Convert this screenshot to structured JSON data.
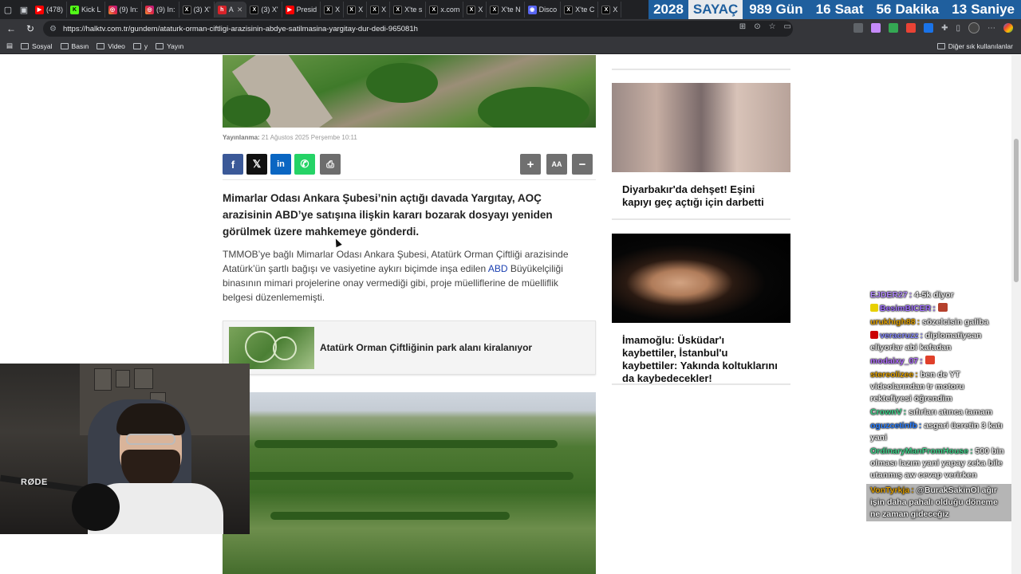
{
  "browser": {
    "tabs": [
      {
        "label": "(478)",
        "icon": "youtube"
      },
      {
        "label": "Kick L",
        "icon": "kick"
      },
      {
        "label": "(9) In:",
        "icon": "instagram"
      },
      {
        "label": "(9) In:",
        "icon": "instagram"
      },
      {
        "label": "(3) X'",
        "icon": "x"
      },
      {
        "label": "A",
        "icon": "halktv"
      },
      {
        "label": "(3) X'",
        "icon": "x"
      },
      {
        "label": "Presid",
        "icon": "youtube"
      },
      {
        "label": "X",
        "icon": "x"
      },
      {
        "label": "X",
        "icon": "x"
      },
      {
        "label": "X",
        "icon": "x"
      },
      {
        "label": "X'te s",
        "icon": "x"
      },
      {
        "label": "x.com",
        "icon": "x"
      },
      {
        "label": "X",
        "icon": "x"
      },
      {
        "label": "X'te N",
        "icon": "x"
      },
      {
        "label": "Disco",
        "icon": "discord"
      },
      {
        "label": "X'te C",
        "icon": "x"
      },
      {
        "label": "X",
        "icon": "x"
      }
    ],
    "url": "https://halktv.com.tr/gundem/ataturk-orman-ciftligi-arazisinin-abdye-satilmasina-yargitay-dur-dedi-965081h",
    "bookmarks": [
      {
        "label": "Sosyal"
      },
      {
        "label": "Basın"
      },
      {
        "label": "Video"
      },
      {
        "label": "y"
      },
      {
        "label": "Yayın"
      }
    ],
    "bookmarks_other": "Diğer sık kullanılanlar"
  },
  "countdown": {
    "year": "2028",
    "title": "SAYAÇ",
    "days": "989",
    "days_label": "Gün",
    "hours": "16",
    "hours_label": "Saat",
    "minutes": "56",
    "minutes_label": "Dakika",
    "seconds": "13",
    "seconds_label": "Saniye"
  },
  "article": {
    "pub_label": "Yayınlanma:",
    "pub_date": "21 Ağustos 2025 Perşembe 10:11",
    "share": {
      "facebook": "f",
      "x": "𝕏",
      "linkedin": "in",
      "whatsapp": "✆",
      "print": "⎙"
    },
    "tools": {
      "increase": "+",
      "font": "AA",
      "decrease": "−"
    },
    "lead": "Mimarlar Odası Ankara Şubesi’nin açtığı davada Yargıtay, AOÇ arazisinin ABD’ye satışına ilişkin kararı bozarak dosyayı yeniden görülmek üzere mahkemeye gönderdi.",
    "body_before": "TMMOB’ye bağlı Mimarlar Odası Ankara Şubesi, Atatürk Orman Çiftliği arazisinde Atatürk’ün şartlı bağışı ve vasiyetine aykırı biçimde inşa edilen ",
    "body_link": "ABD",
    "body_after": " Büyükelçiliği binasının mimari projelerine onay vermediği gibi, proje müelliflerine de müellifl­ik belgesi düzenlememişti.",
    "related_title": "Atatürk Orman Çiftliğinin park alanı kiralanıyor"
  },
  "sidebar": {
    "cards": [
      {
        "title": "Diyarbakır'da dehşet! Eşini kapıyı geç açtığı için darbetti"
      },
      {
        "title": "İmamoğlu: Üsküdar'ı kaybettiler, İstanbul'u kaybettiler: Yakında koltuklarını da kaybedecekler!"
      }
    ]
  },
  "chat": {
    "messages": [
      {
        "user": "EJDER27",
        "color": "#b48cff",
        "text": "4-5k diyor"
      },
      {
        "user": "BesimBICER",
        "color": "#a070ff",
        "text": ""
      },
      {
        "user": "urukhigh88",
        "color": "#e0a000",
        "text": "sözelcisin galiba"
      },
      {
        "user": "veracruzz",
        "color": "#8a8cff",
        "text": "diplomatiysan eliyorlar abi kafadan"
      },
      {
        "user": "modaixy_07",
        "color": "#b06cff",
        "text": ""
      },
      {
        "user": "stereolizee",
        "color": "#e0a000",
        "text": "ben de YT videolarından tr motoru rektefiyesi öğrendim"
      },
      {
        "user": "CrownV",
        "color": "#3fd28a",
        "text": "sıfırları atınca tamam"
      },
      {
        "user": "oguzcetinfb",
        "color": "#2b7fff",
        "text": "asgari ücretin 3 katı yani"
      },
      {
        "user": "OrdinaryManFromHouse",
        "color": "#3fd28a",
        "text": "500 bin olması lazım yani yapay zeka bile utanmış aw cevap verirken"
      },
      {
        "user": "VonTyrkja",
        "color": "#e0a000",
        "text": "@BurakSakinOl ağır işin daha pahalı olduğu döneme ne zaman gideceğiz"
      }
    ]
  },
  "webcam": {
    "brand": "RØDE"
  }
}
